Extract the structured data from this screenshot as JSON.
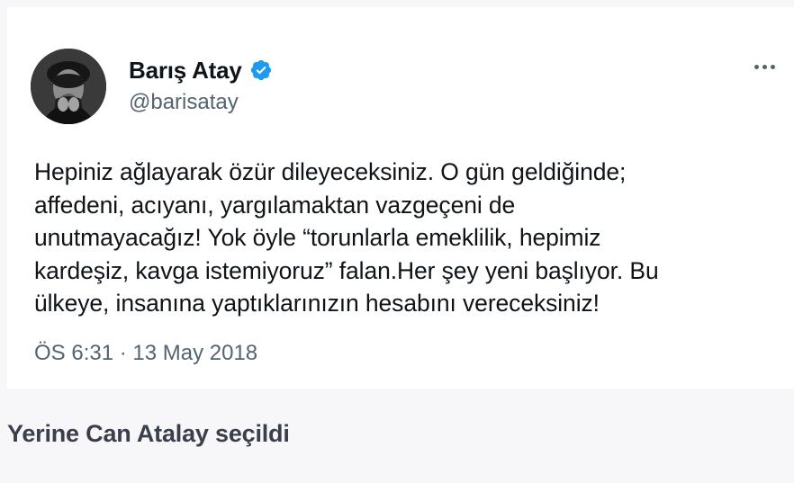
{
  "tweet": {
    "display_name": "Barış Atay",
    "handle": "@barisatay",
    "text": "Hepiniz ağlayarak özür dileyeceksiniz. O gün geldiğinde;\naffedeni, acıyanı, yargılamaktan vazgeçeni de\nunutmayacağız! Yok öyle “torunlarla emeklilik, hepimiz\nkardeşiz, kavga istemiyoruz” falan.Her şey yeni başlıyor. Bu\nülkeye, insanına yaptıklarınızın hesabını vereceksiniz!",
    "timestamp": "ÖS 6:31 · 13 May 2018",
    "verified_color": "#1d9bf0",
    "icons": {
      "verified": "verified-badge-icon",
      "more": "more-options-icon",
      "avatar": "profile-avatar"
    }
  },
  "caption": "Yerine Can Atalay seçildi"
}
